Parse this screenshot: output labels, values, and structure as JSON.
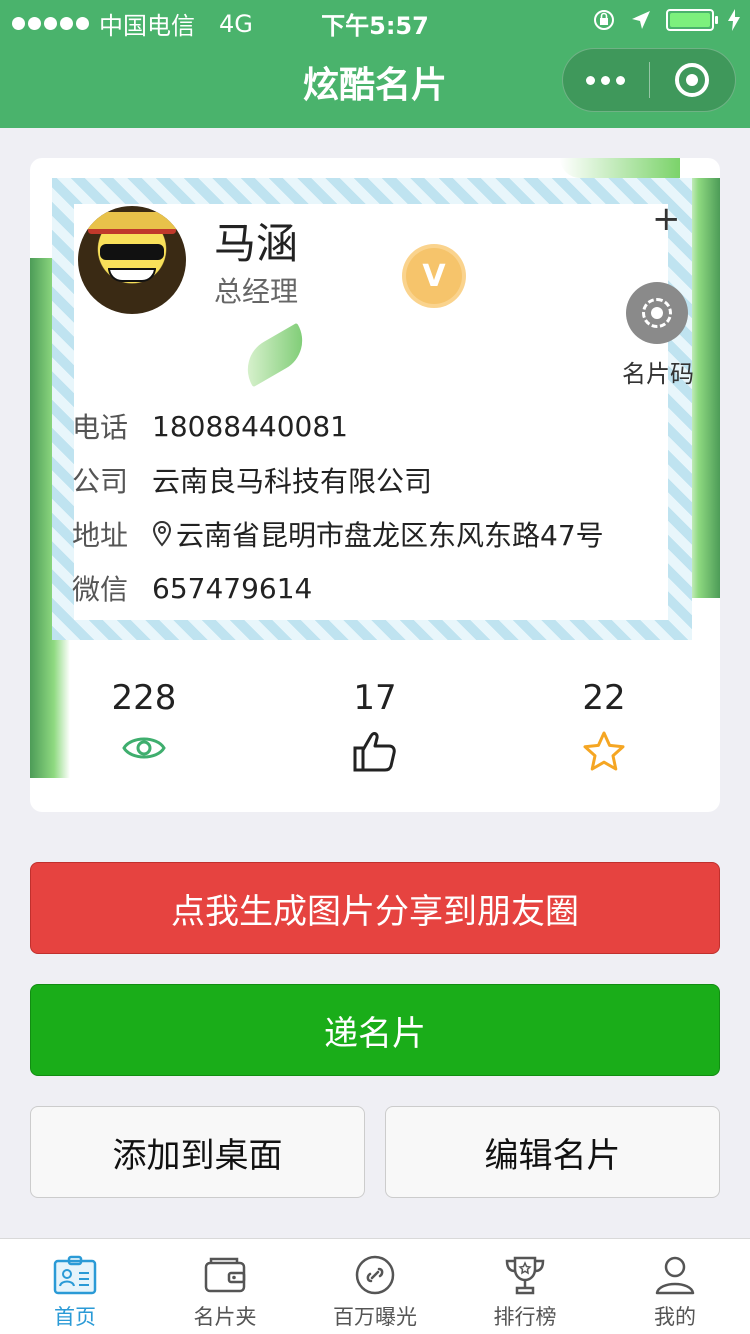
{
  "status_bar": {
    "carrier": "中国电信",
    "network": "4G",
    "time": "下午5:57"
  },
  "nav": {
    "title": "炫酷名片"
  },
  "card": {
    "name": "马涵",
    "title": "总经理",
    "verified_badge": "V",
    "add_symbol": "+",
    "qr_label": "名片码",
    "rows": [
      {
        "label": "电话",
        "value": "18088440081"
      },
      {
        "label": "公司",
        "value": "云南良马科技有限公司"
      },
      {
        "label": "地址",
        "value": "云南省昆明市盘龙区东风东路47号"
      },
      {
        "label": "微信",
        "value": "657479614"
      }
    ],
    "stats": [
      {
        "value": "228",
        "icon": "eye-icon"
      },
      {
        "value": "17",
        "icon": "thumbs-up-icon"
      },
      {
        "value": "22",
        "icon": "star-icon"
      }
    ]
  },
  "buttons": {
    "share": "点我生成图片分享到朋友圈",
    "pass_card": "递名片",
    "add_desktop": "添加到桌面",
    "edit_card": "编辑名片"
  },
  "tabbar": {
    "items": [
      {
        "label": "首页",
        "icon": "id-card-icon",
        "active": true
      },
      {
        "label": "名片夹",
        "icon": "wallet-icon",
        "active": false
      },
      {
        "label": "百万曝光",
        "icon": "link-circle-icon",
        "active": false
      },
      {
        "label": "排行榜",
        "icon": "trophy-icon",
        "active": false
      },
      {
        "label": "我的",
        "icon": "user-icon",
        "active": false
      }
    ]
  },
  "colors": {
    "nav_green": "#4ab36c",
    "share_red": "#e64340",
    "primary_green": "#1aad19",
    "active_tab_blue": "#2a9ad6",
    "star_orange": "#f5a623",
    "eye_green": "#3fae6e"
  }
}
